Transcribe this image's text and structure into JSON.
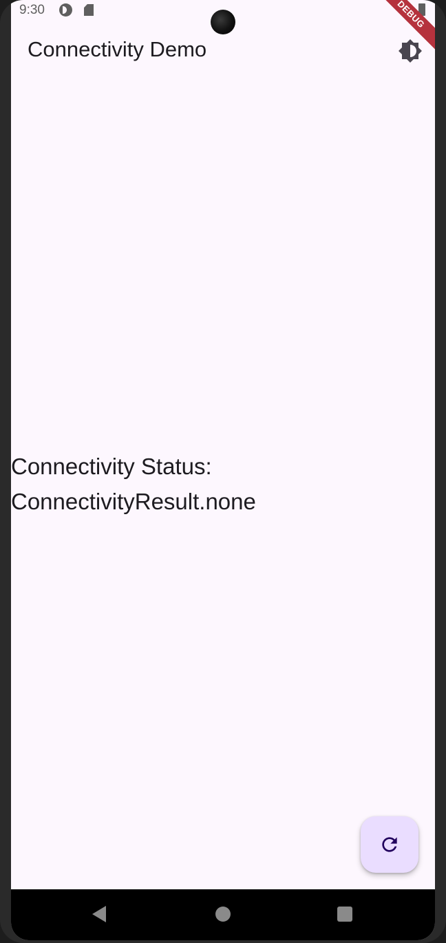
{
  "status_bar": {
    "time": "9:30",
    "icons": [
      "data-saver-icon",
      "sd-card-icon",
      "signal-icon",
      "battery-icon"
    ]
  },
  "debug_banner": "DEBUG",
  "app_bar": {
    "title": "Connectivity Demo",
    "action_icon": "brightness-icon"
  },
  "main": {
    "status_line1": "Connectivity Status:",
    "status_line2": "ConnectivityResult.none"
  },
  "fab": {
    "icon": "refresh-icon"
  },
  "nav_bar": {
    "icons": [
      "back-icon",
      "home-icon",
      "recents-icon"
    ]
  },
  "colors": {
    "background": "#fdf7fe",
    "fab_background": "#eaddff",
    "fab_icon": "#21005d",
    "text": "#1d1b20",
    "debug_banner": "#b5323d"
  }
}
